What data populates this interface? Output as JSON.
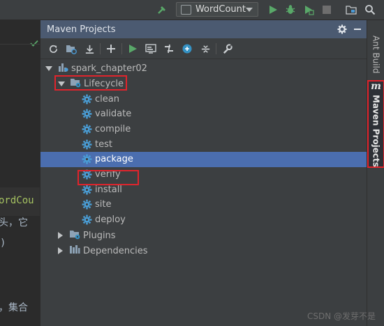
{
  "top_toolbar": {
    "run_config": "WordCount",
    "icons": [
      "hammer-icon",
      "run-icon",
      "debug-icon",
      "coverage-icon",
      "stop-icon",
      "project-structure-icon",
      "search-icon"
    ],
    "colors": {
      "run": "#59a869",
      "hammer": "#59a869",
      "debug": "#59a869"
    }
  },
  "editor": {
    "fragments": [
      "ordCou",
      "头，它",
      ")",
      "，集合"
    ]
  },
  "panel": {
    "title": "Maven Projects",
    "toolbar_icons": [
      "refresh-icon",
      "generate-sources-icon",
      "download-icon",
      "add-icon",
      "run-maven-build-icon",
      "execute-goal-icon",
      "toggle-offline-icon",
      "skip-tests-icon",
      "show-dependencies-icon",
      "collapse-all-icon",
      "settings-wrench-icon"
    ],
    "tree": {
      "project": "spark_chapter02",
      "lifecycle": {
        "label": "Lifecycle",
        "goals": [
          "clean",
          "validate",
          "compile",
          "test",
          "package",
          "verify",
          "install",
          "site",
          "deploy"
        ],
        "selected": "package"
      },
      "plugins": "Plugins",
      "dependencies": "Dependencies"
    },
    "highlight_color": "#e0242c",
    "selection_color": "#4b6eaf"
  },
  "right_stripe": {
    "tabs": [
      "Ant Build",
      "Maven Projects"
    ],
    "active": "Maven Projects"
  },
  "watermark": "CSDN @发芽不是"
}
